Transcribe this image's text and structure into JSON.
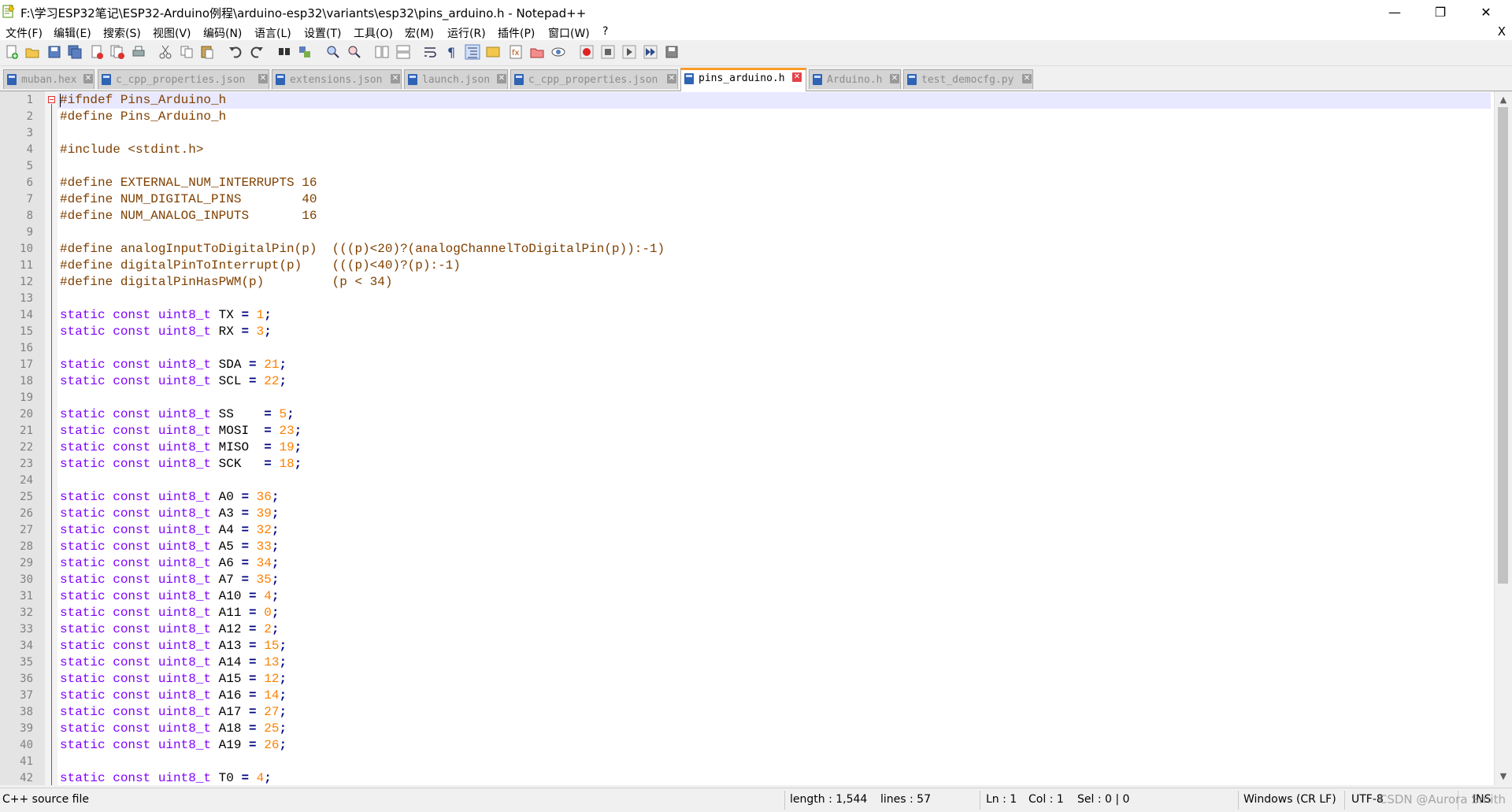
{
  "window": {
    "title": "F:\\学习ESP32笔记\\ESP32-Arduino例程\\arduino-esp32\\variants\\esp32\\pins_arduino.h - Notepad++",
    "minimize": "—",
    "restore": "❐",
    "close": "✕"
  },
  "menu": {
    "items": [
      "文件(F)",
      "编辑(E)",
      "搜索(S)",
      "视图(V)",
      "编码(N)",
      "语言(L)",
      "设置(T)",
      "工具(O)",
      "宏(M)",
      "运行(R)",
      "插件(P)",
      "窗口(W)",
      "?"
    ],
    "close": "X"
  },
  "toolbar": {
    "icons": [
      "new-file-icon",
      "open-file-icon",
      "save-icon",
      "save-all-icon",
      "close-icon",
      "close-all-icon",
      "print-icon",
      "cut-icon",
      "copy-icon",
      "paste-icon",
      "undo-icon",
      "redo-icon",
      "find-icon",
      "replace-icon",
      "zoom-in-icon",
      "zoom-out-icon",
      "sync-vertical-icon",
      "sync-horizontal-icon",
      "word-wrap-icon",
      "show-all-chars-icon",
      "indent-guide-icon",
      "doc-map-icon",
      "function-list-icon",
      "folder-workspace-icon",
      "monitoring-icon",
      "record-macro-icon",
      "stop-record-icon",
      "play-macro-icon",
      "run-macro-multiple-icon",
      "save-macro-icon"
    ]
  },
  "tabs": [
    {
      "label": "muban.hex",
      "active": false
    },
    {
      "label": "c_cpp_properties.json",
      "active": false
    },
    {
      "label": "extensions.json",
      "active": false
    },
    {
      "label": "launch.json",
      "active": false
    },
    {
      "label": "c_cpp_properties.json",
      "active": false
    },
    {
      "label": "pins_arduino.h",
      "active": true
    },
    {
      "label": "Arduino.h",
      "active": false
    },
    {
      "label": "test_democfg.py",
      "active": false
    }
  ],
  "editor": {
    "lines": [
      [
        [
          "pre",
          "#ifndef Pins_Arduino_h"
        ]
      ],
      [
        [
          "pre",
          "#define Pins_Arduino_h"
        ]
      ],
      [],
      [
        [
          "pre",
          "#include <stdint.h>"
        ]
      ],
      [],
      [
        [
          "pre",
          "#define EXTERNAL_NUM_INTERRUPTS 16"
        ]
      ],
      [
        [
          "pre",
          "#define NUM_DIGITAL_PINS        40"
        ]
      ],
      [
        [
          "pre",
          "#define NUM_ANALOG_INPUTS       16"
        ]
      ],
      [],
      [
        [
          "pre",
          "#define analogInputToDigitalPin(p)  (((p)<20)?(analogChannelToDigitalPin(p)):-1)"
        ]
      ],
      [
        [
          "pre",
          "#define digitalPinToInterrupt(p)    (((p)<40)?(p):-1)"
        ]
      ],
      [
        [
          "pre",
          "#define digitalPinHasPWM(p)         (p < 34)"
        ]
      ],
      [],
      [
        [
          "kw",
          "static const uint8_t"
        ],
        [
          "id",
          " TX "
        ],
        [
          "op",
          "="
        ],
        [
          "id",
          " "
        ],
        [
          "num",
          "1"
        ],
        [
          "op",
          ";"
        ]
      ],
      [
        [
          "kw",
          "static const uint8_t"
        ],
        [
          "id",
          " RX "
        ],
        [
          "op",
          "="
        ],
        [
          "id",
          " "
        ],
        [
          "num",
          "3"
        ],
        [
          "op",
          ";"
        ]
      ],
      [],
      [
        [
          "kw",
          "static const uint8_t"
        ],
        [
          "id",
          " SDA "
        ],
        [
          "op",
          "="
        ],
        [
          "id",
          " "
        ],
        [
          "num",
          "21"
        ],
        [
          "op",
          ";"
        ]
      ],
      [
        [
          "kw",
          "static const uint8_t"
        ],
        [
          "id",
          " SCL "
        ],
        [
          "op",
          "="
        ],
        [
          "id",
          " "
        ],
        [
          "num",
          "22"
        ],
        [
          "op",
          ";"
        ]
      ],
      [],
      [
        [
          "kw",
          "static const uint8_t"
        ],
        [
          "id",
          " SS    "
        ],
        [
          "op",
          "="
        ],
        [
          "id",
          " "
        ],
        [
          "num",
          "5"
        ],
        [
          "op",
          ";"
        ]
      ],
      [
        [
          "kw",
          "static const uint8_t"
        ],
        [
          "id",
          " MOSI  "
        ],
        [
          "op",
          "="
        ],
        [
          "id",
          " "
        ],
        [
          "num",
          "23"
        ],
        [
          "op",
          ";"
        ]
      ],
      [
        [
          "kw",
          "static const uint8_t"
        ],
        [
          "id",
          " MISO  "
        ],
        [
          "op",
          "="
        ],
        [
          "id",
          " "
        ],
        [
          "num",
          "19"
        ],
        [
          "op",
          ";"
        ]
      ],
      [
        [
          "kw",
          "static const uint8_t"
        ],
        [
          "id",
          " SCK   "
        ],
        [
          "op",
          "="
        ],
        [
          "id",
          " "
        ],
        [
          "num",
          "18"
        ],
        [
          "op",
          ";"
        ]
      ],
      [],
      [
        [
          "kw",
          "static const uint8_t"
        ],
        [
          "id",
          " A0 "
        ],
        [
          "op",
          "="
        ],
        [
          "id",
          " "
        ],
        [
          "num",
          "36"
        ],
        [
          "op",
          ";"
        ]
      ],
      [
        [
          "kw",
          "static const uint8_t"
        ],
        [
          "id",
          " A3 "
        ],
        [
          "op",
          "="
        ],
        [
          "id",
          " "
        ],
        [
          "num",
          "39"
        ],
        [
          "op",
          ";"
        ]
      ],
      [
        [
          "kw",
          "static const uint8_t"
        ],
        [
          "id",
          " A4 "
        ],
        [
          "op",
          "="
        ],
        [
          "id",
          " "
        ],
        [
          "num",
          "32"
        ],
        [
          "op",
          ";"
        ]
      ],
      [
        [
          "kw",
          "static const uint8_t"
        ],
        [
          "id",
          " A5 "
        ],
        [
          "op",
          "="
        ],
        [
          "id",
          " "
        ],
        [
          "num",
          "33"
        ],
        [
          "op",
          ";"
        ]
      ],
      [
        [
          "kw",
          "static const uint8_t"
        ],
        [
          "id",
          " A6 "
        ],
        [
          "op",
          "="
        ],
        [
          "id",
          " "
        ],
        [
          "num",
          "34"
        ],
        [
          "op",
          ";"
        ]
      ],
      [
        [
          "kw",
          "static const uint8_t"
        ],
        [
          "id",
          " A7 "
        ],
        [
          "op",
          "="
        ],
        [
          "id",
          " "
        ],
        [
          "num",
          "35"
        ],
        [
          "op",
          ";"
        ]
      ],
      [
        [
          "kw",
          "static const uint8_t"
        ],
        [
          "id",
          " A10 "
        ],
        [
          "op",
          "="
        ],
        [
          "id",
          " "
        ],
        [
          "num",
          "4"
        ],
        [
          "op",
          ";"
        ]
      ],
      [
        [
          "kw",
          "static const uint8_t"
        ],
        [
          "id",
          " A11 "
        ],
        [
          "op",
          "="
        ],
        [
          "id",
          " "
        ],
        [
          "num",
          "0"
        ],
        [
          "op",
          ";"
        ]
      ],
      [
        [
          "kw",
          "static const uint8_t"
        ],
        [
          "id",
          " A12 "
        ],
        [
          "op",
          "="
        ],
        [
          "id",
          " "
        ],
        [
          "num",
          "2"
        ],
        [
          "op",
          ";"
        ]
      ],
      [
        [
          "kw",
          "static const uint8_t"
        ],
        [
          "id",
          " A13 "
        ],
        [
          "op",
          "="
        ],
        [
          "id",
          " "
        ],
        [
          "num",
          "15"
        ],
        [
          "op",
          ";"
        ]
      ],
      [
        [
          "kw",
          "static const uint8_t"
        ],
        [
          "id",
          " A14 "
        ],
        [
          "op",
          "="
        ],
        [
          "id",
          " "
        ],
        [
          "num",
          "13"
        ],
        [
          "op",
          ";"
        ]
      ],
      [
        [
          "kw",
          "static const uint8_t"
        ],
        [
          "id",
          " A15 "
        ],
        [
          "op",
          "="
        ],
        [
          "id",
          " "
        ],
        [
          "num",
          "12"
        ],
        [
          "op",
          ";"
        ]
      ],
      [
        [
          "kw",
          "static const uint8_t"
        ],
        [
          "id",
          " A16 "
        ],
        [
          "op",
          "="
        ],
        [
          "id",
          " "
        ],
        [
          "num",
          "14"
        ],
        [
          "op",
          ";"
        ]
      ],
      [
        [
          "kw",
          "static const uint8_t"
        ],
        [
          "id",
          " A17 "
        ],
        [
          "op",
          "="
        ],
        [
          "id",
          " "
        ],
        [
          "num",
          "27"
        ],
        [
          "op",
          ";"
        ]
      ],
      [
        [
          "kw",
          "static const uint8_t"
        ],
        [
          "id",
          " A18 "
        ],
        [
          "op",
          "="
        ],
        [
          "id",
          " "
        ],
        [
          "num",
          "25"
        ],
        [
          "op",
          ";"
        ]
      ],
      [
        [
          "kw",
          "static const uint8_t"
        ],
        [
          "id",
          " A19 "
        ],
        [
          "op",
          "="
        ],
        [
          "id",
          " "
        ],
        [
          "num",
          "26"
        ],
        [
          "op",
          ";"
        ]
      ],
      [],
      [
        [
          "kw",
          "static const uint8_t"
        ],
        [
          "id",
          " T0 "
        ],
        [
          "op",
          "="
        ],
        [
          "id",
          " "
        ],
        [
          "num",
          "4"
        ],
        [
          "op",
          ";"
        ]
      ]
    ]
  },
  "scrollbar": {
    "up": "▲",
    "down": "▼"
  },
  "status": {
    "file_type": "C++ source file",
    "length": "length : 1,544",
    "lines": "lines : 57",
    "ln": "Ln : 1",
    "col": "Col : 1",
    "sel": "Sel : 0 | 0",
    "eol": "Windows (CR LF)",
    "encoding": "UTF-8",
    "mode": "INS",
    "watermark": "CSDN @Aurora Smith"
  },
  "colors": {
    "preprocessor": "#804000",
    "keyword": "#8000ff",
    "number": "#ff8000",
    "operator": "#000080",
    "active_tab_accent": "#fa9b28",
    "current_line": "#e8e8ff"
  }
}
